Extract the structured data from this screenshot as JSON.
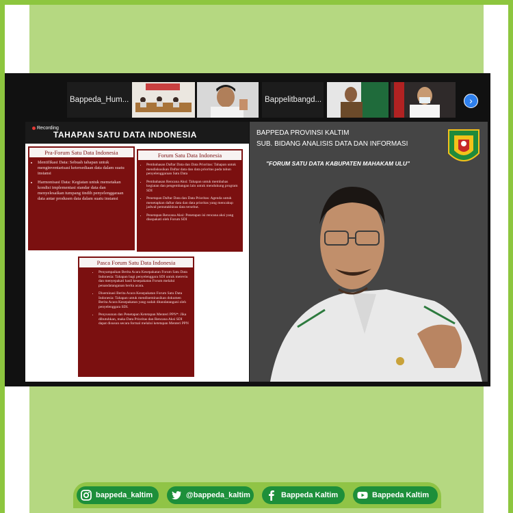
{
  "participants": [
    {
      "name": "Bappeda_Hum..."
    },
    {
      "name": ""
    },
    {
      "name": ""
    },
    {
      "name": "Bappelitbangd..."
    },
    {
      "name": ""
    },
    {
      "name": ""
    }
  ],
  "recording_label": "Recording",
  "slide": {
    "title": "TAHAPAN SATU DATA INDONESIA",
    "pra_forum": {
      "title": "Pra-Forum Satu Data Indonesia",
      "items": [
        "Identifikasi Data: Sebuah tahapan untuk menginventarisasi ketersediaan data dalam suatu instansi",
        "Harmonisasi Data: Kegiatan untuk memetakan kondisi implementasi standar data dan menyelesaikan tumpang tindih penyelenggaraan data antar produsen data dalam suatu instansi"
      ]
    },
    "forum": {
      "title": "Forum Satu Data Indonesia",
      "items": [
        "Pembahasan Daftar Data dan Data Prioritas: Tahapan untuk mendiskusikan Daftar data dan data prioritas pada tahun penyelenggaraan Satu Data",
        "Pembahasan Rencana Aksi: Tahapan untuk membahas kegiatan dan pengembangan lain untuk mendukung program SDI",
        "Penetapan Daftar Data dan Data Prioritas: Agenda untuk menetapkan daftar data dan data prioritas yang mencakup jadwal pemutakhiran data tersebut.",
        "Penetapan Rencana Aksi: Penetapan isi rencana aksi yang disepakati oleh Forum SDI"
      ]
    },
    "pasca_forum": {
      "title": "Pasca Forum Satu Data Indonesia",
      "items": [
        "Penyampaikan Berita Acara Kesepakatan Forum Satu Data Indonesia: Tahapan bagi penyelenggara SDI untuk mereviu dan menyepakati hasil kesepakatan Forum melalui penandatanganan berita acara.",
        "Diseminasi Berita Acara Kesepakatan Forum Satu Data Indonesia: Tahapan untuk mendiseminasikan dokumen Berita Acara Kesepakatan yang sudah ditandatangani oleh penyelenggara SDI.",
        "Penyusunan dan Penetapan Ketetapan Menteri PPN*: Jika dibutuhkan, maka Data Prioritas dan Rencana Aksi SDI dapat disusun secara formal melalui ketetapan Menteri PPN"
      ]
    }
  },
  "speaker_background": {
    "line1": "BAPPEDA PROVINSI KALTIM",
    "line2": "SUB. BIDANG ANALISIS DATA DAN INFORMASI",
    "line3": "\"FORUM SATU DATA KABUPATEN MAHAKAM ULU\""
  },
  "social": [
    {
      "icon": "instagram-icon",
      "label": "bappeda_kaltim"
    },
    {
      "icon": "twitter-icon",
      "label": "@bappeda_kaltim"
    },
    {
      "icon": "facebook-icon",
      "label": "Bappeda Kaltim"
    },
    {
      "icon": "youtube-icon",
      "label": "Bappeda Kaltim"
    }
  ],
  "colors": {
    "frame_green": "#8dc63f",
    "panel_green": "#b5d881",
    "pill_green": "#1d8f3a",
    "slide_maroon": "#7b1010"
  }
}
